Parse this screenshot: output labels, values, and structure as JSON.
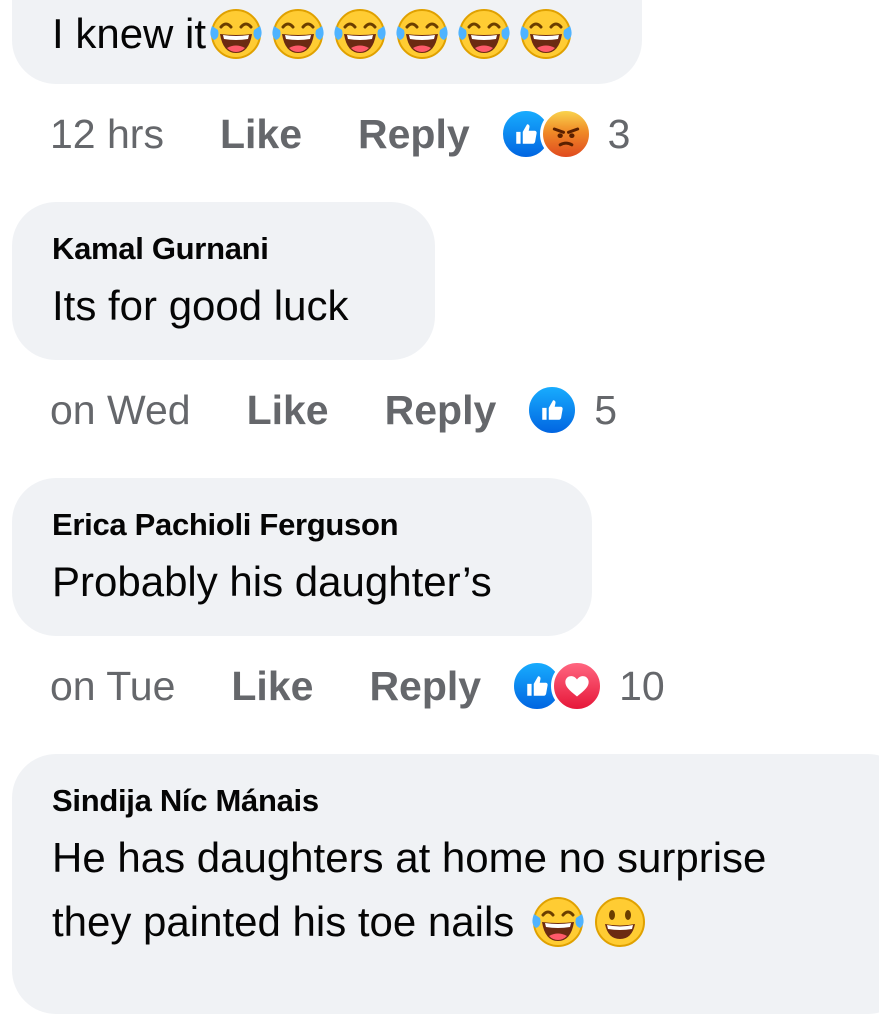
{
  "comments": [
    {
      "author": "",
      "text": "I knew it",
      "trailing_emojis": [
        "face-with-tears-of-joy",
        "face-with-tears-of-joy",
        "face-with-tears-of-joy",
        "face-with-tears-of-joy",
        "face-with-tears-of-joy",
        "face-with-tears-of-joy"
      ],
      "time": "12 hrs",
      "like_label": "Like",
      "reply_label": "Reply",
      "reactions": [
        "like-reaction-icon",
        "angry-reaction-icon"
      ],
      "reaction_count": "3"
    },
    {
      "author": "Kamal Gurnani",
      "text": "Its for good luck",
      "time": "on Wed",
      "like_label": "Like",
      "reply_label": "Reply",
      "reactions": [
        "like-reaction-icon"
      ],
      "reaction_count": "5"
    },
    {
      "author": "Erica Pachioli Ferguson",
      "text": "Probably his daughter’s",
      "time": "on Tue",
      "like_label": "Like",
      "reply_label": "Reply",
      "reactions": [
        "like-reaction-icon",
        "love-reaction-icon"
      ],
      "reaction_count": "10"
    },
    {
      "author": "Sindija Níc Mánais",
      "text_line1": "He has daughters at home no surprise",
      "text_line2": "they painted his toe nails",
      "trailing_emojis": [
        "face-with-tears-of-joy",
        "grinning-face"
      ]
    }
  ],
  "colors": {
    "bubble": "#f0f2f5",
    "meta_text": "#65676b",
    "like_blue": "#0866ff",
    "love_red": "#f33e58",
    "angry_orange": "#e9710f"
  }
}
